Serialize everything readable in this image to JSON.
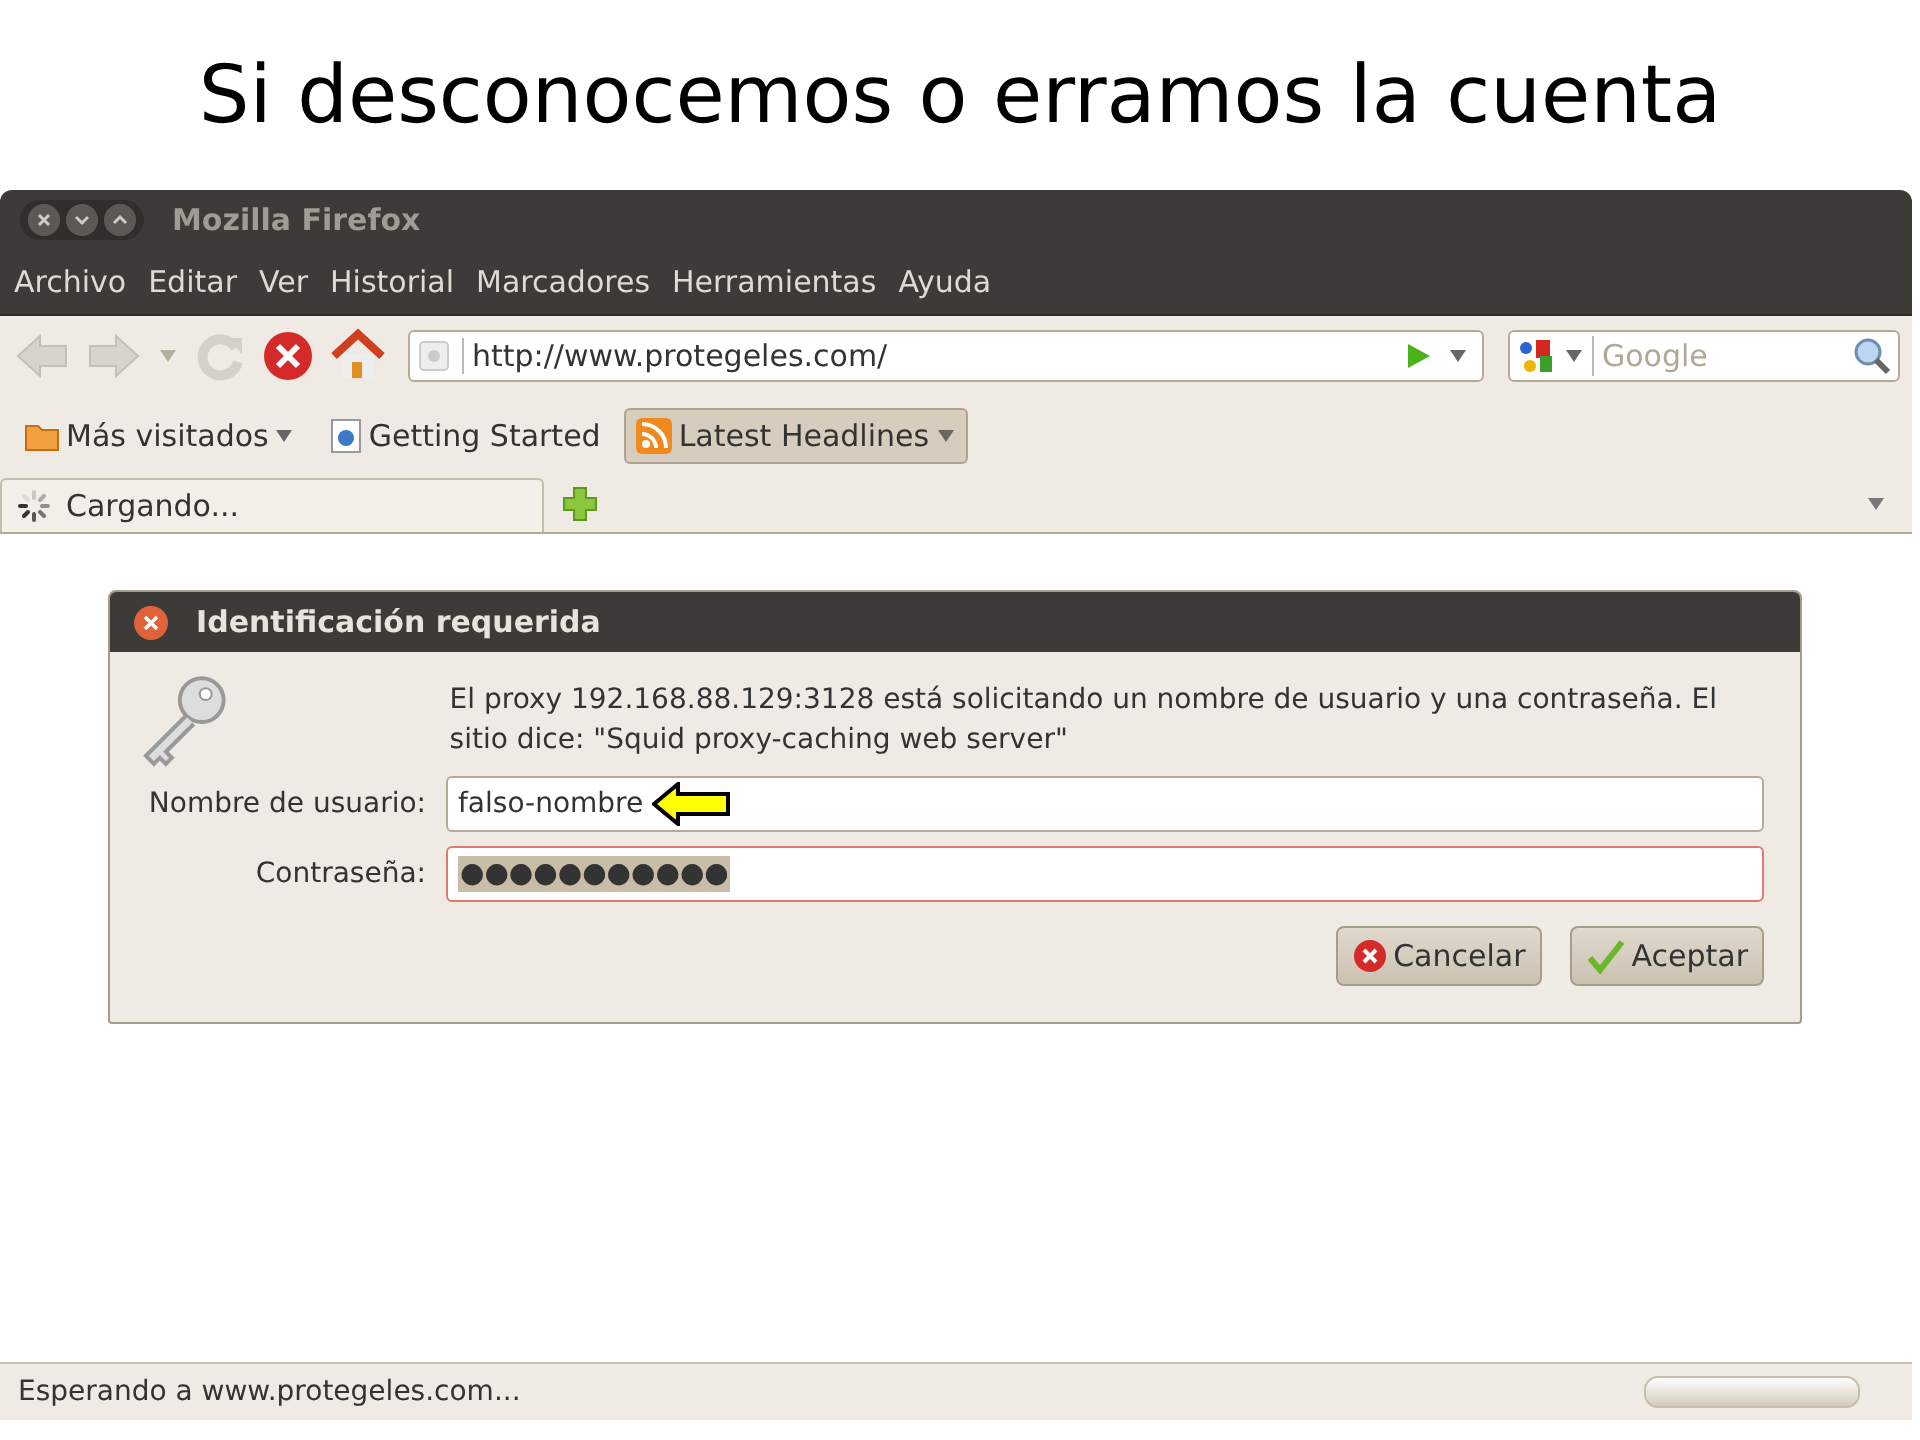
{
  "slide_title": "Si desconocemos o erramos la cuenta",
  "window": {
    "title": "Mozilla Firefox"
  },
  "menu": [
    "Archivo",
    "Editar",
    "Ver",
    "Historial",
    "Marcadores",
    "Herramientas",
    "Ayuda"
  ],
  "address_bar": {
    "value": "http://www.protegeles.com/"
  },
  "search": {
    "placeholder": "Google"
  },
  "bookmarks": [
    {
      "label": "Más visitados",
      "kind": "folder",
      "selected": false,
      "dropdown": true
    },
    {
      "label": "Getting Started",
      "kind": "page",
      "selected": false,
      "dropdown": false
    },
    {
      "label": "Latest Headlines",
      "kind": "feed",
      "selected": true,
      "dropdown": true
    }
  ],
  "tabs": [
    {
      "label": "Cargando...",
      "selected": true,
      "loading": true
    }
  ],
  "dialog": {
    "title": "Identificación requerida",
    "message": "El proxy 192.168.88.129:3128 está solicitando un nombre de usuario y una contraseña. El sitio dice: \"Squid proxy-caching web server\"",
    "fields": [
      {
        "label": "Nombre de usuario:",
        "value": "falso-nombre",
        "pointer": true,
        "error": false,
        "selected_text": false
      },
      {
        "label": "Contraseña:",
        "value": "●●●●●●●●●●●",
        "pointer": false,
        "error": true,
        "selected_text": true
      }
    ],
    "buttons": [
      {
        "label": "Cancelar",
        "kind": "cancel"
      },
      {
        "label": "Aceptar",
        "kind": "ok"
      }
    ]
  },
  "status_bar": {
    "text": "Esperando a www.protegeles.com...",
    "progress": {
      "level": 0
    }
  }
}
